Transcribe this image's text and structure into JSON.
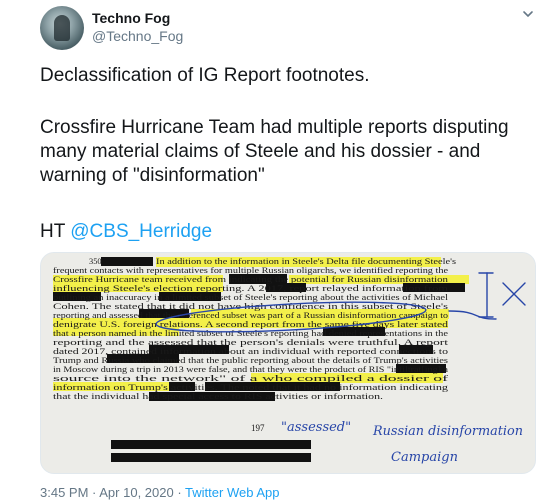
{
  "user": {
    "display_name": "Techno Fog",
    "handle": "@Techno_Fog"
  },
  "tweet": {
    "line1": "Declassification of IG Report footnotes.",
    "line2": "Crossfire Hurricane Team had multiple reports disputing many material claims of Steele and his dossier - and warning of \"disinformation\"",
    "ht_prefix": "HT ",
    "mention": "@CBS_Herridge"
  },
  "document": {
    "footnote_number": "350",
    "lines": [
      "In addition to the information in Steele's Delta file documenting Steele's",
      "frequent contacts with representatives for multiple Russian oligarchs, we identified reporting the",
      "Crossfire Hurricane team received from          indicating the potential for Russian disinformation",
      "influencing Steele's election reporting. A          2017, report relayed information from",
      "          outlining an inaccuracy in a limited subset of Steele's reporting about the activities of Michael",
      "Cohen. The          stated that it did not have high confidence in this subset of Steele's",
      "reporting and assessed that the referenced subset was part of a Russian disinformation campaign to",
      "denigrate U.S. foreign relations. A second report from the same          five days later stated",
      "that a person named in the limited subset of Steele's reporting had denied representations in the",
      "reporting and the          assessed that the person's denials were truthful. A          report",
      "dated          2017, contained information about an individual with reported connections to",
      "Trump and Russia who claimed that the public reporting about the details of Trump's          activities",
      "in Moscow during a trip in 2013 were false, and that they were the product of RIS \"infiltrat[ing] a",
      "source into the network\" of a          who compiled a dossier of",
      "information on Trump's activities. The          noted that it had no information indicating",
      "that the individual had special access to RIS activities or information."
    ],
    "page_number": "197",
    "handwriting_1": "\"assessed\"",
    "handwriting_2": "Russian disinformation",
    "handwriting_3": "Campaign"
  },
  "meta": {
    "time": "3:45 PM",
    "sep1": " · ",
    "date": "Apr 10, 2020",
    "sep2": " · ",
    "app": "Twitter Web App"
  },
  "colors": {
    "highlight": "#f3f04a",
    "link": "#1da1f2",
    "ink": "#2846a8"
  }
}
